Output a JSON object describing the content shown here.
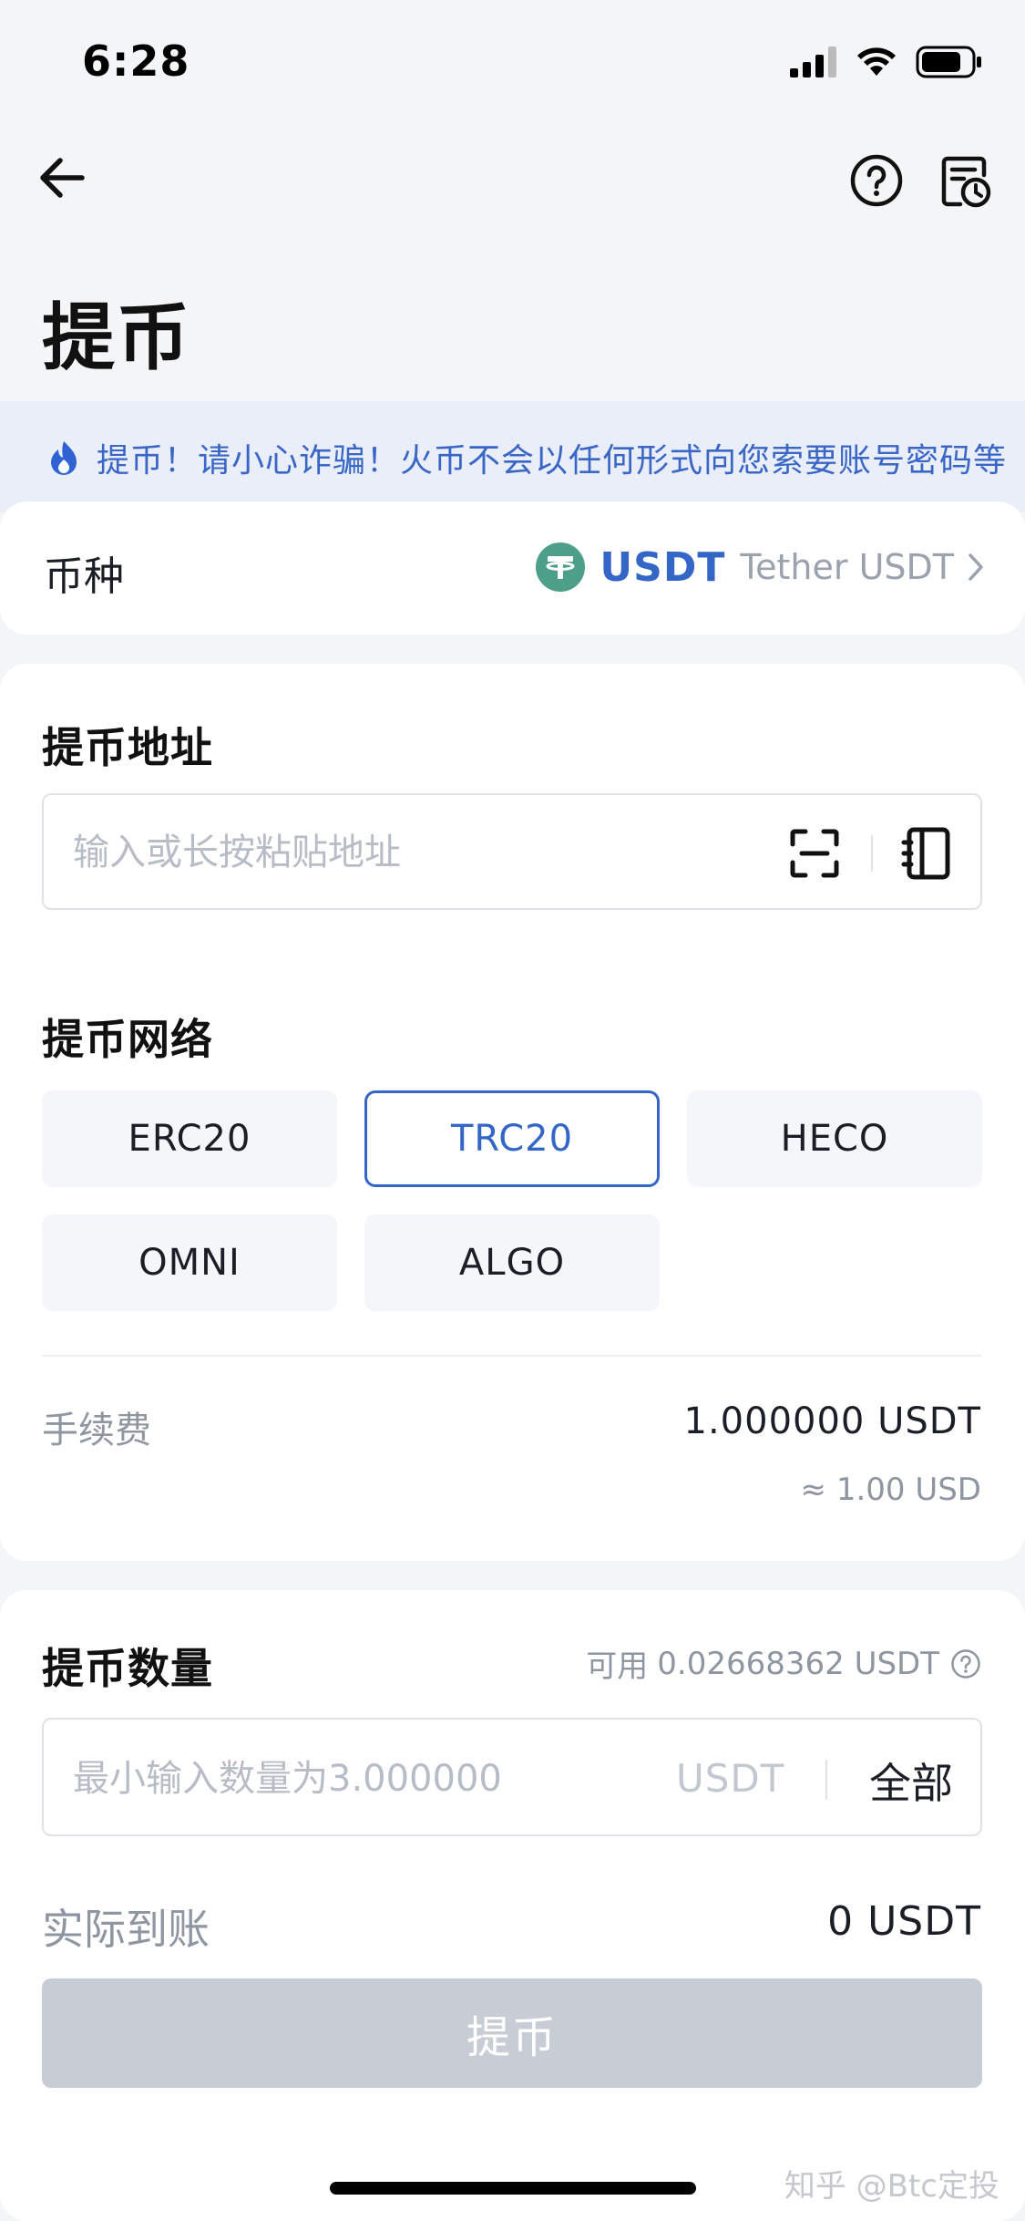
{
  "status_bar": {
    "time": "6:28"
  },
  "header": {
    "title": "提币",
    "icons": [
      "back-arrow-icon",
      "question-circle-icon",
      "record-icon"
    ]
  },
  "notice": {
    "text": "提币！请小心诈骗！火币不会以任何形式向您索要账号密码等"
  },
  "coin": {
    "label": "币种",
    "symbol": "USDT",
    "name": "Tether USDT",
    "logo_color": "#4e9f89"
  },
  "address": {
    "title": "提币地址",
    "placeholder": "输入或长按粘贴地址",
    "icons": [
      "scan-icon",
      "address-book-icon"
    ]
  },
  "network": {
    "title": "提币网络",
    "options": [
      "ERC20",
      "TRC20",
      "HECO",
      "OMNI",
      "ALGO"
    ],
    "selected": "TRC20"
  },
  "fee": {
    "label": "手续费",
    "value": "1.000000 USDT",
    "usd": "≈ 1.00 USD"
  },
  "amount": {
    "title": "提币数量",
    "available_label": "可用",
    "available_value": "0.02668362 USDT",
    "placeholder": "最小输入数量为3.000000",
    "unit": "USDT",
    "all_label": "全部"
  },
  "actual": {
    "label": "实际到账",
    "value": "0 USDT"
  },
  "submit": {
    "label": "提币"
  },
  "watermark": "知乎 @Btc定投",
  "colors": {
    "accent": "#3466c8",
    "notice_bg": "#e9eef9",
    "disabled_button": "#c8ccd5"
  }
}
